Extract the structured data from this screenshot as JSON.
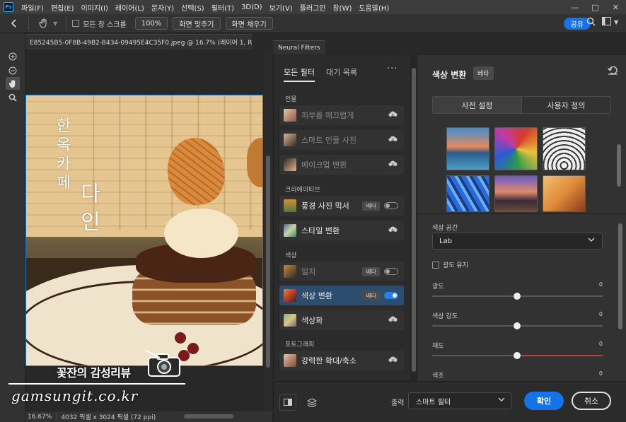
{
  "menubar": {
    "logo": "Ps",
    "items": [
      "파일(F)",
      "편집(E)",
      "이미지(I)",
      "레이어(L)",
      "문자(Y)",
      "선택(S)",
      "필터(T)",
      "3D(D)",
      "보기(V)",
      "플러그인",
      "창(W)",
      "도움말(H)"
    ],
    "window_controls": [
      "—",
      "□",
      "✕"
    ]
  },
  "optionsbar": {
    "all_windows_scroll": "모든 창 스크롤",
    "zoom_100": "100%",
    "fit_screen": "화면 맞추기",
    "fill_screen": "화면 채우기",
    "share": "공유"
  },
  "document": {
    "tab_title": "E85245B5-0F8B-49B2-B434-09495E4C35F0.jpeg @ 16.7% (레이어 1, RG...",
    "tab_close": "✕",
    "zoom": "16.67%",
    "size": "4032 픽셀 x 3024 픽셀 (72 ppi)"
  },
  "photo": {
    "vertical_text": [
      "한",
      "옥",
      "카",
      "페"
    ],
    "big_text": [
      "다",
      "인"
    ]
  },
  "watermark": {
    "title": "꽃잔의 감성리뷰",
    "url": "gamsungit.co.kr"
  },
  "neural_filters": {
    "panel_tab": "Neural Filters",
    "tabs": [
      "모든 필터",
      "대기 목록"
    ],
    "more": "···",
    "categories": {
      "portrait": "인물",
      "creative": "크리에이티브",
      "color": "색상",
      "photography": "포토그래피"
    },
    "filters": [
      {
        "name": "피부를 매끄럽게",
        "dim": true,
        "action": "cloud"
      },
      {
        "name": "스마트 인물 사진",
        "dim": true,
        "action": "cloud"
      },
      {
        "name": "메이크업 변환",
        "dim": true,
        "action": "cloud"
      },
      {
        "name": "풍경 사진 믹서",
        "dim": false,
        "action": "toggle",
        "beta": "베타",
        "on": false
      },
      {
        "name": "스타일 변환",
        "dim": false,
        "action": "cloud"
      },
      {
        "name": "일치",
        "dim": true,
        "action": "toggle",
        "beta": "베타",
        "on": false
      },
      {
        "name": "색상 변환",
        "dim": false,
        "action": "toggle",
        "beta": "베타",
        "on": true
      },
      {
        "name": "색상화",
        "dim": false,
        "action": "cloud"
      },
      {
        "name": "강력한 확대/축소",
        "dim": false,
        "action": "cloud"
      }
    ],
    "detail": {
      "title": "색상 변환",
      "beta": "베타",
      "segments": [
        "사전 설정",
        "사용자 정의"
      ],
      "color_space_label": "색상 공간",
      "color_space_value": "Lab",
      "preserve_luminance": "광도 유지",
      "sliders": [
        {
          "label": "광도",
          "value": "0"
        },
        {
          "label": "색상 강도",
          "value": "0"
        },
        {
          "label": "채도",
          "value": "0"
        },
        {
          "label": "색조",
          "value": "0"
        }
      ]
    },
    "bottom": {
      "output_label": "출력",
      "output_value": "스마트 필터",
      "ok": "확인",
      "cancel": "취소"
    }
  },
  "colors": {
    "accent_blue": "#1473e6",
    "selected_row": "#2d4d6e",
    "canvas_border": "#1f7fd1"
  }
}
